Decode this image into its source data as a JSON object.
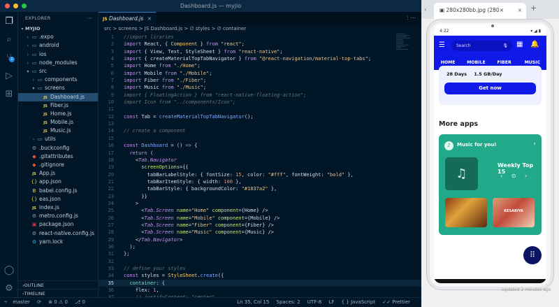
{
  "vscode": {
    "window_title": "Dashboard.js — myjio",
    "traffic": {
      "close": "#ff5f57",
      "min": "#febc2e",
      "max": "#28c840"
    },
    "activity_icons": [
      "files-icon",
      "search-icon",
      "source-control-icon",
      "run-debug-icon",
      "extensions-icon"
    ],
    "activity_badge": "1",
    "explorer": {
      "title": "EXPLORER",
      "root": "MYJIO",
      "items": [
        {
          "label": ".expo",
          "depth": 1,
          "type": "folder",
          "open": false
        },
        {
          "label": "android",
          "depth": 1,
          "type": "folder",
          "open": false
        },
        {
          "label": "ios",
          "depth": 1,
          "type": "folder",
          "open": false
        },
        {
          "label": "node_modules",
          "depth": 1,
          "type": "folder",
          "open": false
        },
        {
          "label": "src",
          "depth": 1,
          "type": "folder",
          "open": true
        },
        {
          "label": "components",
          "depth": 2,
          "type": "folder",
          "open": false
        },
        {
          "label": "screens",
          "depth": 2,
          "type": "folder",
          "open": true
        },
        {
          "label": "Dashboard.js",
          "depth": 3,
          "type": "js",
          "selected": true
        },
        {
          "label": "Fiber.js",
          "depth": 3,
          "type": "js"
        },
        {
          "label": "Home.js",
          "depth": 3,
          "type": "js"
        },
        {
          "label": "Mobile.js",
          "depth": 3,
          "type": "js"
        },
        {
          "label": "Music.js",
          "depth": 3,
          "type": "js"
        },
        {
          "label": "utils",
          "depth": 2,
          "type": "folder",
          "open": false
        },
        {
          "label": ".buckconfig",
          "depth": 1,
          "type": "config"
        },
        {
          "label": ".gitattributes",
          "depth": 1,
          "type": "git"
        },
        {
          "label": ".gitignore",
          "depth": 1,
          "type": "git"
        },
        {
          "label": "App.js",
          "depth": 1,
          "type": "js"
        },
        {
          "label": "app.json",
          "depth": 1,
          "type": "json"
        },
        {
          "label": "babel.config.js",
          "depth": 1,
          "type": "babel"
        },
        {
          "label": "eas.json",
          "depth": 1,
          "type": "json"
        },
        {
          "label": "index.js",
          "depth": 1,
          "type": "js"
        },
        {
          "label": "metro.config.js",
          "depth": 1,
          "type": "config"
        },
        {
          "label": "package.json",
          "depth": 1,
          "type": "npm"
        },
        {
          "label": "react-native.config.js",
          "depth": 1,
          "type": "config"
        },
        {
          "label": "yarn.lock",
          "depth": 1,
          "type": "yarn"
        }
      ],
      "outline": "OUTLINE",
      "timeline": "TIMELINE"
    },
    "tab": {
      "label": "Dashboard.js",
      "close": "×",
      "actions": "⫶  ⋯"
    },
    "breadcrumb": "src > screens > JS Dashboard.js > ∅ styles > ∅ container",
    "code_lines": [
      {
        "n": "1",
        "toks": [
          [
            "c",
            "//import liraries"
          ]
        ]
      },
      {
        "n": "2",
        "toks": [
          [
            "k",
            "import"
          ],
          [
            "p",
            " React, { "
          ],
          [
            "y",
            "Component"
          ],
          [
            "p",
            " } "
          ],
          [
            "k",
            "from"
          ],
          [
            "s",
            " \"react\""
          ],
          [
            "p",
            ";"
          ]
        ]
      },
      {
        "n": "3",
        "toks": [
          [
            "k",
            "import"
          ],
          [
            "p",
            " { View, Text, StyleSheet } "
          ],
          [
            "k",
            "from"
          ],
          [
            "s",
            " \"react-native\""
          ],
          [
            "p",
            ";"
          ]
        ]
      },
      {
        "n": "4",
        "toks": [
          [
            "k",
            "import"
          ],
          [
            "p",
            " { createMaterialTopTabNavigator } "
          ],
          [
            "k",
            "from"
          ],
          [
            "s",
            " \"@react-navigation/material-top-tabs\""
          ],
          [
            "p",
            ";"
          ]
        ]
      },
      {
        "n": "5",
        "toks": [
          [
            "k",
            "import"
          ],
          [
            "p",
            " Home "
          ],
          [
            "k",
            "from"
          ],
          [
            "s",
            " \"./Home\""
          ],
          [
            "p",
            ";"
          ]
        ]
      },
      {
        "n": "6",
        "toks": [
          [
            "k",
            "import"
          ],
          [
            "p",
            " Mobile "
          ],
          [
            "k",
            "from"
          ],
          [
            "s",
            " \"./Mobile\""
          ],
          [
            "p",
            ";"
          ]
        ]
      },
      {
        "n": "7",
        "toks": [
          [
            "k",
            "import"
          ],
          [
            "p",
            " Fiber "
          ],
          [
            "k",
            "from"
          ],
          [
            "s",
            " \"./Fiber\""
          ],
          [
            "p",
            ";"
          ]
        ]
      },
      {
        "n": "8",
        "toks": [
          [
            "k",
            "import"
          ],
          [
            "p",
            " Music "
          ],
          [
            "k",
            "from"
          ],
          [
            "s",
            " \"./Music\""
          ],
          [
            "p",
            ";"
          ]
        ]
      },
      {
        "n": "9",
        "toks": [
          [
            "c",
            "import { FloatingAction } from \"react-native-floating-action\";"
          ]
        ]
      },
      {
        "n": "10",
        "toks": [
          [
            "c",
            "import Icon from \"../components/Icon\";"
          ]
        ]
      },
      {
        "n": "11",
        "toks": []
      },
      {
        "n": "12",
        "toks": [
          [
            "k",
            "const"
          ],
          [
            "p",
            " Tab = "
          ],
          [
            "f",
            "createMaterialTopTabNavigator"
          ],
          [
            "p",
            "();"
          ]
        ]
      },
      {
        "n": "13",
        "toks": []
      },
      {
        "n": "14",
        "toks": [
          [
            "c",
            "// create a component"
          ]
        ]
      },
      {
        "n": "15",
        "toks": []
      },
      {
        "n": "16",
        "toks": [
          [
            "k",
            "const"
          ],
          [
            "p",
            " "
          ],
          [
            "f",
            "Dashboard"
          ],
          [
            "p",
            " = () "
          ],
          [
            "k",
            "=>"
          ],
          [
            "p",
            " {"
          ]
        ]
      },
      {
        "n": "17",
        "toks": [
          [
            "p",
            "  "
          ],
          [
            "k",
            "return"
          ],
          [
            "p",
            " ("
          ]
        ]
      },
      {
        "n": "18",
        "toks": [
          [
            "p",
            "    <"
          ],
          [
            "i",
            "Tab.Navigator"
          ]
        ]
      },
      {
        "n": "19",
        "toks": [
          [
            "p",
            "      "
          ],
          [
            "a",
            "screenOptions"
          ],
          [
            "p",
            "={{"
          ]
        ]
      },
      {
        "n": "20",
        "toks": [
          [
            "p",
            "        tabBarLabelStyle: { fontSize: "
          ],
          [
            "n",
            "15"
          ],
          [
            "p",
            ", color: "
          ],
          [
            "s",
            "\"#fff\""
          ],
          [
            "p",
            ", fontWeight: "
          ],
          [
            "s",
            "\"bold\""
          ],
          [
            "p",
            " },"
          ]
        ]
      },
      {
        "n": "21",
        "toks": [
          [
            "p",
            "        tabBarItemStyle: { width: "
          ],
          [
            "n",
            "100"
          ],
          [
            "p",
            " },"
          ]
        ]
      },
      {
        "n": "22",
        "toks": [
          [
            "p",
            "        tabBarStyle: { backgroundColor: "
          ],
          [
            "s",
            "\"#1837a2\""
          ],
          [
            "p",
            " },"
          ]
        ]
      },
      {
        "n": "23",
        "toks": [
          [
            "p",
            "      }}"
          ]
        ]
      },
      {
        "n": "24",
        "toks": [
          [
            "p",
            "    >"
          ]
        ]
      },
      {
        "n": "25",
        "toks": [
          [
            "p",
            "      <"
          ],
          [
            "i",
            "Tab.Screen"
          ],
          [
            "p",
            " "
          ],
          [
            "a",
            "name"
          ],
          [
            "p",
            "="
          ],
          [
            "s",
            "\"Home\""
          ],
          [
            "p",
            " "
          ],
          [
            "a",
            "component"
          ],
          [
            "p",
            "={Home} />"
          ]
        ]
      },
      {
        "n": "26",
        "toks": [
          [
            "p",
            "      <"
          ],
          [
            "i",
            "Tab.Screen"
          ],
          [
            "p",
            " "
          ],
          [
            "a",
            "name"
          ],
          [
            "p",
            "="
          ],
          [
            "s",
            "\"Mobile\""
          ],
          [
            "p",
            " "
          ],
          [
            "a",
            "component"
          ],
          [
            "p",
            "={Mobile} />"
          ]
        ]
      },
      {
        "n": "27",
        "toks": [
          [
            "p",
            "      <"
          ],
          [
            "i",
            "Tab.Screen"
          ],
          [
            "p",
            " "
          ],
          [
            "a",
            "name"
          ],
          [
            "p",
            "="
          ],
          [
            "s",
            "\"Fiber\""
          ],
          [
            "p",
            " "
          ],
          [
            "a",
            "component"
          ],
          [
            "p",
            "={Fiber} />"
          ]
        ]
      },
      {
        "n": "28",
        "toks": [
          [
            "p",
            "      <"
          ],
          [
            "i",
            "Tab.Screen"
          ],
          [
            "p",
            " "
          ],
          [
            "a",
            "name"
          ],
          [
            "p",
            "="
          ],
          [
            "s",
            "\"Music\""
          ],
          [
            "p",
            " "
          ],
          [
            "a",
            "component"
          ],
          [
            "p",
            "={Music} />"
          ]
        ]
      },
      {
        "n": "29",
        "toks": [
          [
            "p",
            "    </"
          ],
          [
            "i",
            "Tab.Navigator"
          ],
          [
            "p",
            ">"
          ]
        ]
      },
      {
        "n": "30",
        "toks": [
          [
            "p",
            "  );"
          ]
        ]
      },
      {
        "n": "31",
        "toks": [
          [
            "p",
            "};"
          ]
        ]
      },
      {
        "n": "32",
        "toks": []
      },
      {
        "n": "33",
        "toks": [
          [
            "c",
            "// define your styles"
          ]
        ]
      },
      {
        "n": "34",
        "toks": [
          [
            "k",
            "const"
          ],
          [
            "p",
            " styles = "
          ],
          [
            "y",
            "StyleSheet"
          ],
          [
            "p",
            "."
          ],
          [
            "f",
            "create"
          ],
          [
            "p",
            "({"
          ]
        ]
      },
      {
        "n": "35",
        "toks": [
          [
            "p",
            "  "
          ],
          [
            "t",
            "container"
          ],
          [
            "p",
            ": {"
          ]
        ],
        "current": true
      },
      {
        "n": "36",
        "toks": [
          [
            "p",
            "    flex: "
          ],
          [
            "n",
            "1"
          ],
          [
            "p",
            ","
          ]
        ]
      },
      {
        "n": "37",
        "toks": [
          [
            "c",
            "    // justifyContent: \"center\","
          ]
        ]
      },
      {
        "n": "38",
        "toks": [
          [
            "c",
            "    // alignItems: \"center\","
          ]
        ]
      }
    ],
    "status": {
      "branch": "master",
      "sync": "⟳",
      "problems": "⊗ 0 ⚠ 0",
      "ports": "⎇ 0",
      "position": "Ln 35, Col 15",
      "spaces": "Spaces: 2",
      "encoding": "UTF-8",
      "eol": "LF",
      "language": "{ } JavaScript",
      "formatter": "✓✓ Prettier"
    }
  },
  "browser": {
    "tab_title": "280x280bb.jpg (280×",
    "tab_close": "×",
    "new_tab": "+",
    "nav": "‹",
    "phone": {
      "time": "4:22",
      "status_icons": "▾ ◢ ▮",
      "search_placeholder": "Search",
      "tabs": [
        "HOME",
        "MOBILE",
        "FIBER",
        "MUSIC"
      ],
      "plan_days": "28 Days",
      "plan_data": "1.5 GB/Day",
      "get_now": "Get now",
      "more_apps": "More apps",
      "music_title": "Music for you!",
      "weekly": "Weekly Top 15",
      "thumb2_caption": "KESARIYA"
    },
    "footer_note": "Updated 2 minutes ago"
  },
  "colors": {
    "editor_bg": "#011627",
    "jio_blue": "#0f19e8",
    "music_green": "#22a98a"
  }
}
